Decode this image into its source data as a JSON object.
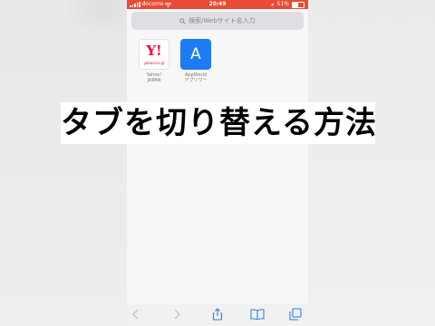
{
  "status_bar": {
    "carrier": "docomo",
    "time": "20:49",
    "battery": "51%"
  },
  "search": {
    "placeholder": "検索/Webサイト名入力"
  },
  "favorites": [
    {
      "logo_text": "Y!",
      "logo_sub": "yahoo.co.jp",
      "label_line1": "Yahoo!",
      "label_line2": "JAPAN"
    },
    {
      "logo_text": "A",
      "label_line1": "AppWorld",
      "label_line2": "アプリワー"
    }
  ],
  "overlay": {
    "title": "タブを切り替える方法"
  },
  "toolbar": {
    "icons": [
      "back-arrow-icon",
      "forward-arrow-icon",
      "share-icon",
      "bookmarks-icon",
      "tabs-icon"
    ]
  },
  "colors": {
    "status_bar": "#e94b35",
    "yahoo_red": "#ff0033",
    "app_blue": "#1e7cf2",
    "icon_blue": "#2f7cf6"
  }
}
